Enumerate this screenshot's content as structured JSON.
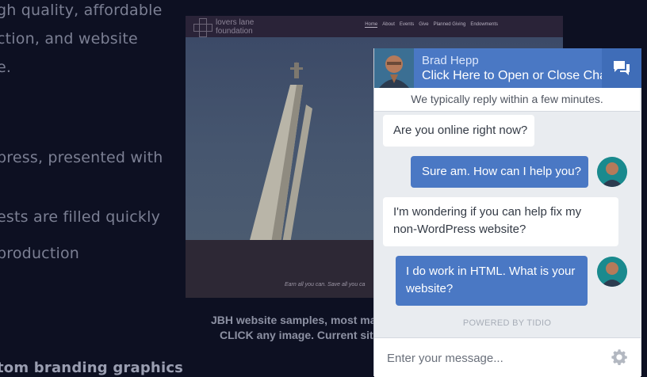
{
  "background": {
    "left_text": [
      "gh quality, affordable",
      "ction, and website",
      "e.",
      "press, presented with",
      "ests are filled quickly",
      " production"
    ],
    "bottom_bold": "tom branding graphics",
    "caption_line1": "JBH website samples, most ma",
    "caption_line2": "CLICK any image. Current site"
  },
  "site_preview": {
    "logo_line1": "lovers lane",
    "logo_line2": "foundation",
    "nav": [
      "Home",
      "About",
      "Events",
      "Give",
      "Planned Giving",
      "Endowments"
    ],
    "caption": "Earn all you can. Save all you ca"
  },
  "chat": {
    "agent_name": "Brad Hepp",
    "cta": "Click Here to Open or Close Chat",
    "reply_notice": "We typically reply within a few minutes.",
    "messages": [
      {
        "from": "visitor",
        "text": "Are you online right now?"
      },
      {
        "from": "agent",
        "text": "Sure am. How can I help you?"
      },
      {
        "from": "visitor",
        "text": "I'm wondering if you can help fix my non-WordPress website?"
      },
      {
        "from": "agent",
        "text": "I do work in HTML. What is your website?"
      }
    ],
    "powered_by": "POWERED BY TIDIO",
    "input_placeholder": "Enter your message...",
    "colors": {
      "header": "#4a78c4",
      "toggle": "#3f6db8",
      "panel": "#e9ecf0"
    }
  }
}
